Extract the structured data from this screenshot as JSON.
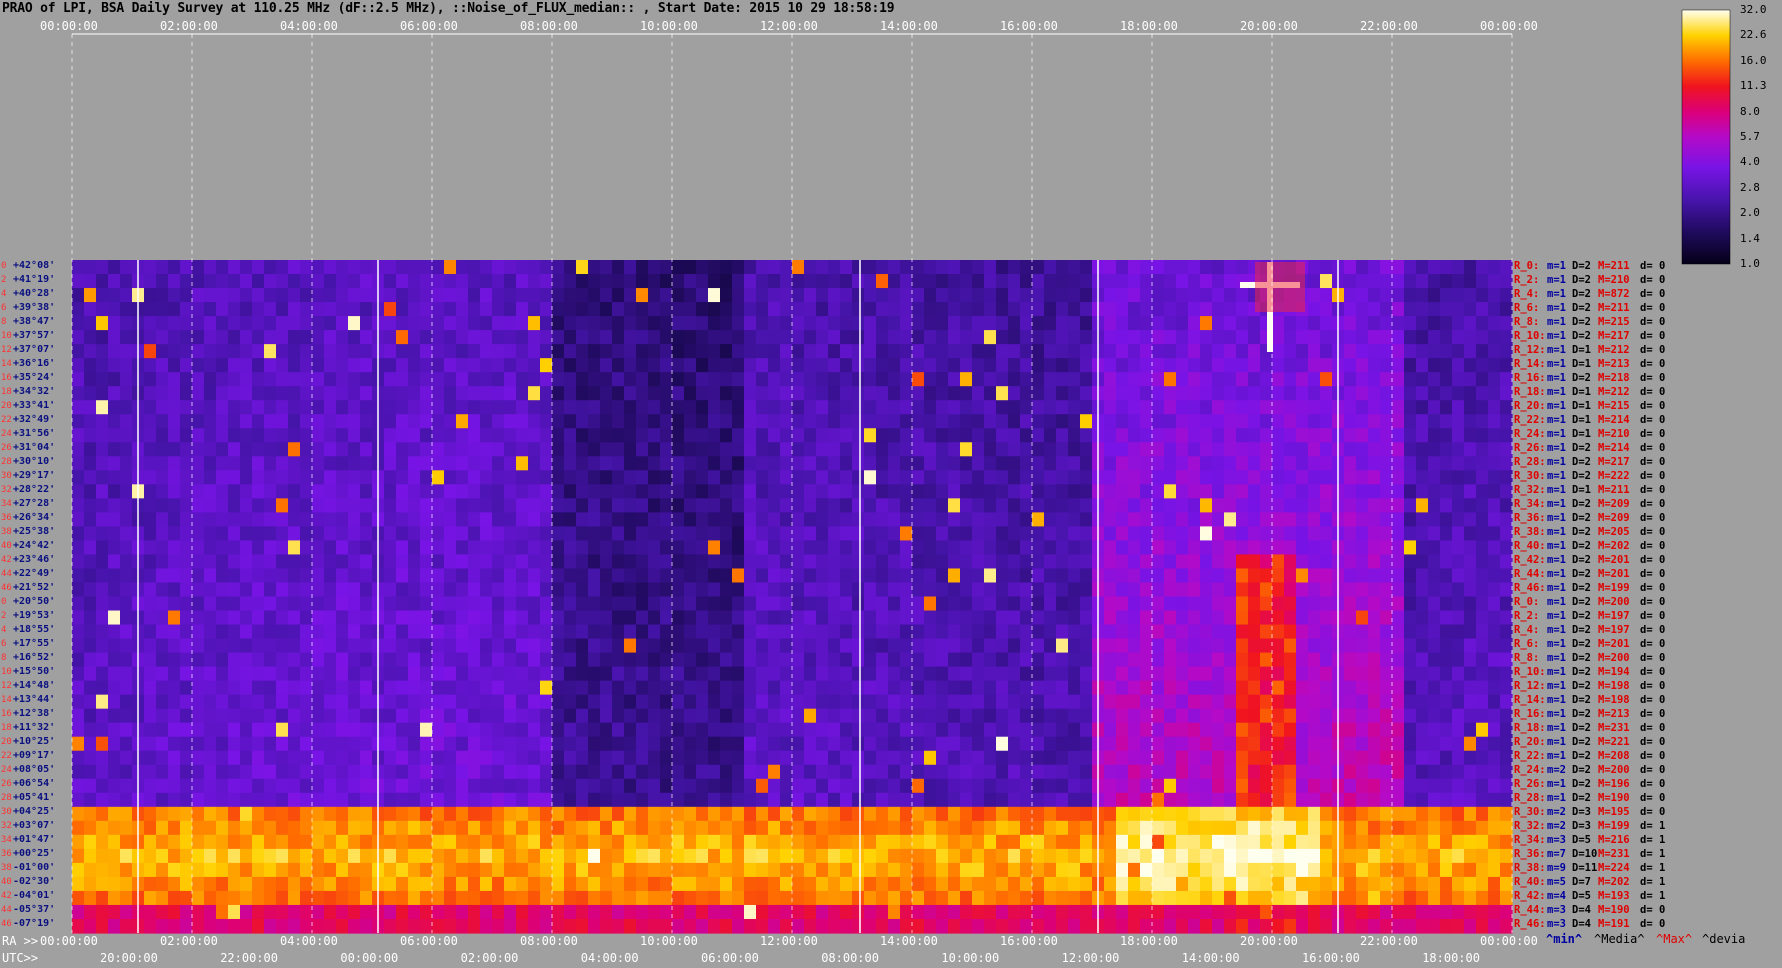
{
  "title": "PRAO of LPI, BSA Daily Survey at 110.25 MHz (dF::2.5 MHz), ::Noise_of_FLUX_median:: , Start Date: 2015 10 29 18:58:19",
  "colorbar": {
    "labels": [
      "32.0",
      "22.6",
      "16.0",
      "11.3",
      "8.0",
      "5.7",
      "4.0",
      "2.8",
      "2.0",
      "1.4",
      "1.0"
    ]
  },
  "top_axis": {
    "labels": [
      "00:00:00",
      "02:00:00",
      "04:00:00",
      "06:00:00",
      "08:00:00",
      "10:00:00",
      "12:00:00",
      "14:00:00",
      "16:00:00",
      "18:00:00",
      "20:00:00",
      "22:00:00",
      "00:00:00"
    ]
  },
  "ra_axis": {
    "prefix": "RA >>",
    "labels": [
      "00:00:00",
      "02:00:00",
      "04:00:00",
      "06:00:00",
      "08:00:00",
      "10:00:00",
      "12:00:00",
      "14:00:00",
      "16:00:00",
      "18:00:00",
      "20:00:00",
      "22:00:00",
      "00:00:00"
    ]
  },
  "utc_axis": {
    "prefix": "UTC>>",
    "labels": [
      "20:00:00",
      "22:00:00",
      "00:00:00",
      "02:00:00",
      "04:00:00",
      "06:00:00",
      "08:00:00",
      "10:00:00",
      "12:00:00",
      "14:00:00",
      "16:00:00",
      "18:00:00"
    ]
  },
  "stat_legend": {
    "min": "^min^",
    "media": "^Media^",
    "max": "^Max^",
    "devia": "^devia"
  },
  "chart_data": {
    "type": "heatmap",
    "title": "PRAO of LPI, BSA Daily Survey at 110.25 MHz (dF::2.5 MHz), ::Noise_of_FLUX_median:: , Start Date: 2015 10 29 18:58:19",
    "colorbar_range": [
      1.0,
      32.0
    ],
    "colorbar_scale": "log",
    "x_range_ra_hours": [
      0,
      24
    ],
    "rows": [
      {
        "idx": "0",
        "dec": "+42°08'",
        "stat": {
          "r": "R_0:",
          "m": "m=1",
          "d": "D=2",
          "M": "M=211",
          "dv": "d= 0"
        }
      },
      {
        "idx": "2",
        "dec": "+41°19'",
        "stat": {
          "r": "R_2:",
          "m": "m=1",
          "d": "D=2",
          "M": "M=210",
          "dv": "d= 0"
        }
      },
      {
        "idx": "4",
        "dec": "+40°28'",
        "stat": {
          "r": "R_4:",
          "m": "m=1",
          "d": "D=2",
          "M": "M=872",
          "dv": "d= 0"
        }
      },
      {
        "idx": "6",
        "dec": "+39°38'",
        "stat": {
          "r": "R_6:",
          "m": "m=1",
          "d": "D=2",
          "M": "M=211",
          "dv": "d= 0"
        }
      },
      {
        "idx": "8",
        "dec": "+38°47'",
        "stat": {
          "r": "R_8:",
          "m": "m=1",
          "d": "D=2",
          "M": "M=215",
          "dv": "d= 0"
        }
      },
      {
        "idx": "10",
        "dec": "+37°57'",
        "stat": {
          "r": "R_10:",
          "m": "m=1",
          "d": "D=2",
          "M": "M=217",
          "dv": "d= 0"
        }
      },
      {
        "idx": "12",
        "dec": "+37°07'",
        "stat": {
          "r": "R_12:",
          "m": "m=1",
          "d": "D=1",
          "M": "M=212",
          "dv": "d= 0"
        }
      },
      {
        "idx": "14",
        "dec": "+36°16'",
        "stat": {
          "r": "R_14:",
          "m": "m=1",
          "d": "D=1",
          "M": "M=213",
          "dv": "d= 0"
        }
      },
      {
        "idx": "16",
        "dec": "+35°24'",
        "stat": {
          "r": "R_16:",
          "m": "m=1",
          "d": "D=2",
          "M": "M=218",
          "dv": "d= 0"
        }
      },
      {
        "idx": "18",
        "dec": "+34°32'",
        "stat": {
          "r": "R_18:",
          "m": "m=1",
          "d": "D=1",
          "M": "M=212",
          "dv": "d= 0"
        }
      },
      {
        "idx": "20",
        "dec": "+33°41'",
        "stat": {
          "r": "R_20:",
          "m": "m=1",
          "d": "D=1",
          "M": "M=215",
          "dv": "d= 0"
        }
      },
      {
        "idx": "22",
        "dec": "+32°49'",
        "stat": {
          "r": "R_22:",
          "m": "m=1",
          "d": "D=1",
          "M": "M=214",
          "dv": "d= 0"
        }
      },
      {
        "idx": "24",
        "dec": "+31°56'",
        "stat": {
          "r": "R_24:",
          "m": "m=1",
          "d": "D=1",
          "M": "M=210",
          "dv": "d= 0"
        }
      },
      {
        "idx": "26",
        "dec": "+31°04'",
        "stat": {
          "r": "R_26:",
          "m": "m=1",
          "d": "D=2",
          "M": "M=214",
          "dv": "d= 0"
        }
      },
      {
        "idx": "28",
        "dec": "+30°10'",
        "stat": {
          "r": "R_28:",
          "m": "m=1",
          "d": "D=2",
          "M": "M=217",
          "dv": "d= 0"
        }
      },
      {
        "idx": "30",
        "dec": "+29°17'",
        "stat": {
          "r": "R_30:",
          "m": "m=1",
          "d": "D=2",
          "M": "M=222",
          "dv": "d= 0"
        }
      },
      {
        "idx": "32",
        "dec": "+28°22'",
        "stat": {
          "r": "R_32:",
          "m": "m=1",
          "d": "D=1",
          "M": "M=211",
          "dv": "d= 0"
        }
      },
      {
        "idx": "34",
        "dec": "+27°28'",
        "stat": {
          "r": "R_34:",
          "m": "m=1",
          "d": "D=2",
          "M": "M=209",
          "dv": "d= 0"
        }
      },
      {
        "idx": "36",
        "dec": "+26°34'",
        "stat": {
          "r": "R_36:",
          "m": "m=1",
          "d": "D=2",
          "M": "M=209",
          "dv": "d= 0"
        }
      },
      {
        "idx": "38",
        "dec": "+25°38'",
        "stat": {
          "r": "R_38:",
          "m": "m=1",
          "d": "D=2",
          "M": "M=205",
          "dv": "d= 0"
        }
      },
      {
        "idx": "40",
        "dec": "+24°42'",
        "stat": {
          "r": "R_40:",
          "m": "m=1",
          "d": "D=2",
          "M": "M=202",
          "dv": "d= 0"
        }
      },
      {
        "idx": "42",
        "dec": "+23°46'",
        "stat": {
          "r": "R_42:",
          "m": "m=1",
          "d": "D=2",
          "M": "M=201",
          "dv": "d= 0"
        }
      },
      {
        "idx": "44",
        "dec": "+22°49'",
        "stat": {
          "r": "R_44:",
          "m": "m=1",
          "d": "D=2",
          "M": "M=201",
          "dv": "d= 0"
        }
      },
      {
        "idx": "46",
        "dec": "+21°52'",
        "stat": {
          "r": "R_46:",
          "m": "m=1",
          "d": "D=2",
          "M": "M=199",
          "dv": "d= 0"
        }
      },
      {
        "idx": "0",
        "dec": "+20°50'",
        "stat": {
          "r": "R_0:",
          "m": "m=1",
          "d": "D=2",
          "M": "M=200",
          "dv": "d= 0"
        }
      },
      {
        "idx": "2",
        "dec": "+19°53'",
        "stat": {
          "r": "R_2:",
          "m": "m=1",
          "d": "D=2",
          "M": "M=197",
          "dv": "d= 0"
        }
      },
      {
        "idx": "4",
        "dec": "+18°55'",
        "stat": {
          "r": "R_4:",
          "m": "m=1",
          "d": "D=2",
          "M": "M=197",
          "dv": "d= 0"
        }
      },
      {
        "idx": "6",
        "dec": "+17°55'",
        "stat": {
          "r": "R_6:",
          "m": "m=1",
          "d": "D=2",
          "M": "M=201",
          "dv": "d= 0"
        }
      },
      {
        "idx": "8",
        "dec": "+16°52'",
        "stat": {
          "r": "R_8:",
          "m": "m=1",
          "d": "D=2",
          "M": "M=200",
          "dv": "d= 0"
        }
      },
      {
        "idx": "10",
        "dec": "+15°50'",
        "stat": {
          "r": "R_10:",
          "m": "m=1",
          "d": "D=2",
          "M": "M=194",
          "dv": "d= 0"
        }
      },
      {
        "idx": "12",
        "dec": "+14°48'",
        "stat": {
          "r": "R_12:",
          "m": "m=1",
          "d": "D=2",
          "M": "M=198",
          "dv": "d= 0"
        }
      },
      {
        "idx": "14",
        "dec": "+13°44'",
        "stat": {
          "r": "R_14:",
          "m": "m=1",
          "d": "D=2",
          "M": "M=198",
          "dv": "d= 0"
        }
      },
      {
        "idx": "16",
        "dec": "+12°38'",
        "stat": {
          "r": "R_16:",
          "m": "m=1",
          "d": "D=2",
          "M": "M=213",
          "dv": "d= 0"
        }
      },
      {
        "idx": "18",
        "dec": "+11°32'",
        "stat": {
          "r": "R_18:",
          "m": "m=1",
          "d": "D=2",
          "M": "M=231",
          "dv": "d= 0"
        }
      },
      {
        "idx": "20",
        "dec": "+10°25'",
        "stat": {
          "r": "R_20:",
          "m": "m=1",
          "d": "D=2",
          "M": "M=221",
          "dv": "d= 0"
        }
      },
      {
        "idx": "22",
        "dec": "+09°17'",
        "stat": {
          "r": "R_22:",
          "m": "m=1",
          "d": "D=2",
          "M": "M=208",
          "dv": "d= 0"
        }
      },
      {
        "idx": "24",
        "dec": "+08°05'",
        "stat": {
          "r": "R_24:",
          "m": "m=2",
          "d": "D=2",
          "M": "M=200",
          "dv": "d= 0"
        }
      },
      {
        "idx": "26",
        "dec": "+06°54'",
        "stat": {
          "r": "R_26:",
          "m": "m=1",
          "d": "D=2",
          "M": "M=196",
          "dv": "d= 0"
        }
      },
      {
        "idx": "28",
        "dec": "+05°41'",
        "stat": {
          "r": "R_28:",
          "m": "m=1",
          "d": "D=2",
          "M": "M=190",
          "dv": "d= 0"
        }
      },
      {
        "idx": "30",
        "dec": "+04°25'",
        "stat": {
          "r": "R_30:",
          "m": "m=2",
          "d": "D=3",
          "M": "M=195",
          "dv": "d= 0"
        }
      },
      {
        "idx": "32",
        "dec": "+03°07'",
        "stat": {
          "r": "R_32:",
          "m": "m=2",
          "d": "D=3",
          "M": "M=199",
          "dv": "d= 1"
        }
      },
      {
        "idx": "34",
        "dec": "+01°47'",
        "stat": {
          "r": "R_34:",
          "m": "m=3",
          "d": "D=5",
          "M": "M=216",
          "dv": "d= 1"
        }
      },
      {
        "idx": "36",
        "dec": "+00°25'",
        "stat": {
          "r": "R_36:",
          "m": "m=7",
          "d": "D=10",
          "M": "M=231",
          "dv": "d= 1"
        }
      },
      {
        "idx": "38",
        "dec": "-01°00'",
        "stat": {
          "r": "R_38:",
          "m": "m=9",
          "d": "D=11",
          "M": "M=224",
          "dv": "d= 1"
        }
      },
      {
        "idx": "40",
        "dec": "-02°30'",
        "stat": {
          "r": "R_40:",
          "m": "m=5",
          "d": "D=7",
          "M": "M=202",
          "dv": "d= 1"
        }
      },
      {
        "idx": "42",
        "dec": "-04°01'",
        "stat": {
          "r": "R_42:",
          "m": "m=4",
          "d": "D=5",
          "M": "M=193",
          "dv": "d= 1"
        }
      },
      {
        "idx": "44",
        "dec": "-05°37'",
        "stat": {
          "r": "R_44:",
          "m": "m=3",
          "d": "D=4",
          "M": "M=190",
          "dv": "d= 0"
        }
      },
      {
        "idx": "46",
        "dec": "-07°19'",
        "stat": {
          "r": "R_46:",
          "m": "m=3",
          "d": "D=4",
          "M": "M=191",
          "dv": "d= 0"
        }
      }
    ]
  },
  "colors": {
    "background": "#a0a0a0",
    "stat_r": "#e00000",
    "stat_m": "#0000a0",
    "stat_d": "#000000",
    "stat_M": "#e00000",
    "stat_dv": "#000000",
    "ra_label": "#0a1080"
  }
}
